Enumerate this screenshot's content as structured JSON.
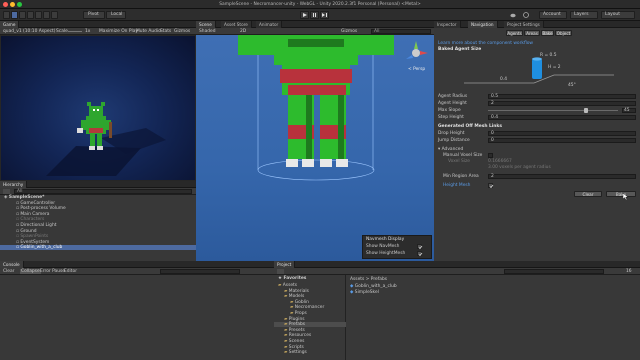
{
  "window": {
    "title": "SampleScene - Necromancer-unity - WebGL - Unity 2020.2.3f1 Personal (Personal) <Metal>"
  },
  "toolbar": {
    "pivot": "Pivot",
    "local": "Local",
    "account": "Account",
    "layers": "Layers",
    "layout": "Layout"
  },
  "game_view": {
    "tab": "Game",
    "display": "quad_v1 (10:10 Aspect)",
    "scale_label": "Scale",
    "scale_value": "1x",
    "maximize": "Maximize On Play",
    "mute": "Mute Audio",
    "stats": "Stats",
    "gizmos": "Gizmos"
  },
  "scene_view": {
    "tabs": [
      "Scene",
      "Asset Store",
      "Animator"
    ],
    "shading": "Shaded",
    "mode_2d": "2D",
    "gizmos": "Gizmos",
    "search": "All",
    "persp": "< Persp",
    "overlay": {
      "title": "Navmesh Display",
      "row1": "Show NavMesh",
      "row2": "Show HeightMesh"
    }
  },
  "inspector": {
    "tabs": [
      "Inspector",
      "Navigation",
      "Project Settings"
    ],
    "subtabs": [
      "Agents",
      "Areas",
      "Bake",
      "Object"
    ],
    "link": "Learn more about the component workflow",
    "section_baked": "Baked Agent Size",
    "diagram": {
      "r": "R = 0.5",
      "h": "H = 2",
      "step": "0.4",
      "angle": "45°"
    },
    "fields": [
      {
        "label": "Agent Radius",
        "value": "0.5"
      },
      {
        "label": "Agent Height",
        "value": "2"
      },
      {
        "label": "Max Slope",
        "value": "45"
      },
      {
        "label": "Step Height",
        "value": "0.4"
      }
    ],
    "max_slope_fraction": 0.75,
    "section_offmesh": "Generated Off Mesh Links",
    "offmesh_fields": [
      {
        "label": "Drop Height",
        "value": "0"
      },
      {
        "label": "Jump Distance",
        "value": "0"
      }
    ],
    "advanced": "Advanced",
    "manual_voxel": "Manual Voxel Size",
    "voxel_size": "Voxel Size",
    "voxel_value": "0.1666667",
    "voxel_hint": "3.00 voxels per agent radius",
    "min_region": {
      "label": "Min Region Area",
      "value": "2"
    },
    "height_mesh": "Height Mesh",
    "clear": "Clear",
    "bake": "Bake"
  },
  "hierarchy": {
    "tab": "Hierarchy",
    "search_all": "All",
    "items": [
      {
        "label": "SampleScene*",
        "depth": 0,
        "bold": true
      },
      {
        "label": "GameController",
        "depth": 1
      },
      {
        "label": "Post-process Volume",
        "depth": 1
      },
      {
        "label": "Main Camera",
        "depth": 1
      },
      {
        "label": "Characters",
        "depth": 1,
        "dim": true
      },
      {
        "label": "Directional Light",
        "depth": 1
      },
      {
        "label": "Ground",
        "depth": 1
      },
      {
        "label": "SpawnPoints",
        "depth": 1,
        "dim": true
      },
      {
        "label": "EventSystem",
        "depth": 1
      },
      {
        "label": "Goblin_with_a_club",
        "depth": 1,
        "selected": true
      }
    ]
  },
  "console": {
    "tab": "Console",
    "clear": "Clear",
    "collapse": "Collapse",
    "error_pause": "Error Pause",
    "editor": "Editor"
  },
  "project": {
    "tab": "Project",
    "favorites": "Favorites",
    "tree": [
      {
        "label": "Assets",
        "depth": 0
      },
      {
        "label": "Materials",
        "depth": 1
      },
      {
        "label": "Models",
        "depth": 1
      },
      {
        "label": "Goblin",
        "depth": 2
      },
      {
        "label": "Necromancer",
        "depth": 2
      },
      {
        "label": "Props",
        "depth": 2
      },
      {
        "label": "Plugins",
        "depth": 1
      },
      {
        "label": "Prefabs",
        "depth": 1,
        "selected": true
      },
      {
        "label": "Presets",
        "depth": 1
      },
      {
        "label": "Resources",
        "depth": 1
      },
      {
        "label": "Scenes",
        "depth": 1
      },
      {
        "label": "Scripts",
        "depth": 1
      },
      {
        "label": "Settings",
        "depth": 1
      }
    ],
    "breadcrumb": "Assets > Prefabs",
    "files": [
      "Goblin_with_a_club",
      "SimpleSkel"
    ],
    "count": "16"
  },
  "colors": {
    "accent": "#4d6aa0",
    "link": "#5a9be6",
    "scene_sky": "#3f6fb4",
    "model_green": "#2dbb2d",
    "model_red": "#b8323c"
  }
}
